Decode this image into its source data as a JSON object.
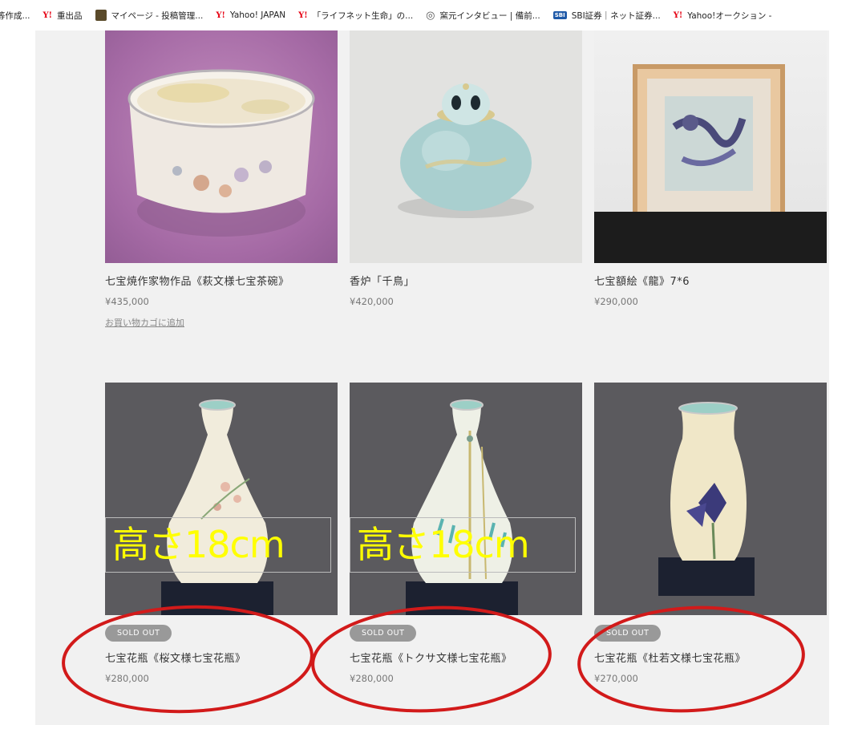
{
  "bookmarks": [
    {
      "icon": "",
      "label": "等作成..."
    },
    {
      "icon": "Y!",
      "label": "重出品"
    },
    {
      "icon": "photo",
      "label": "マイページ - 投稿管理..."
    },
    {
      "icon": "Y!",
      "label": "Yahoo! JAPAN"
    },
    {
      "icon": "Y!",
      "label": "「ライフネット生命」の..."
    },
    {
      "icon": "globe",
      "label": "窯元インタビュー | 備前..."
    },
    {
      "icon": "SBI",
      "label": "SBI証券｜ネット証券..."
    },
    {
      "icon": "Y!",
      "label": "Yahoo!オークション -"
    }
  ],
  "products": [
    {
      "title": "七宝焼作家物作品《萩文様七宝茶碗》",
      "price": "¥435,000",
      "action": "お買い物カゴに追加"
    },
    {
      "title": "香炉「千鳥」",
      "price": "¥420,000"
    },
    {
      "title": "七宝額絵《龍》7*6",
      "price": "¥290,000"
    },
    {
      "title": "七宝花瓶《桜文様七宝花瓶》",
      "price": "¥280,000",
      "badge": "SOLD OUT",
      "overlay": "高さ18cm"
    },
    {
      "title": "七宝花瓶《トクサ文様七宝花瓶》",
      "price": "¥280,000",
      "badge": "SOLD OUT",
      "overlay": "高さ18cm"
    },
    {
      "title": "七宝花瓶《杜若文様七宝花瓶》",
      "price": "¥270,000",
      "badge": "SOLD OUT"
    }
  ],
  "colors": {
    "annotation": "#d21a1a",
    "overlay_text": "#ffff00",
    "badge": "#999999",
    "page_bg": "#f1f1f1"
  }
}
